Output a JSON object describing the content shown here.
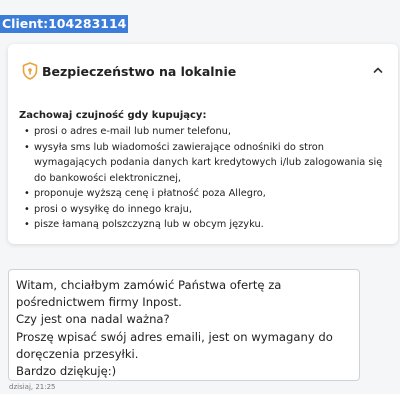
{
  "client_label": "Client:104283114",
  "security_panel": {
    "title": "Bezpieczeństwo na lokalnie",
    "heading": "Zachowaj czujność gdy kupujący:",
    "items": [
      "prosi o adres e-mail lub numer telefonu,",
      "wysyła sms lub wiadomości zawierające odnośniki do stron wymagających podania danych kart kredytowych i/lub zalogowania się do bankowości elektronicznej,",
      "proponuje wyższą cenę i płatność poza Allegro,",
      "prosi o wysyłkę do innego kraju,",
      "pisze łamaną polszczyzną lub w obcym języku."
    ],
    "accent_color": "#e8a33d"
  },
  "message": {
    "text": "Witam, chciałbym zamówić Państwa ofertę za pośrednictwem firmy Inpost.\nCzy jest ona nadal ważna?\nProszę wpisać swój adres emaili, jest on wymagany do doręczenia przesyłki.\nBardzo dziękuję:)",
    "timestamp": "dzisiaj, 21:25"
  },
  "icons": {
    "shield": "shield-icon",
    "collapse": "chevron-up-icon"
  },
  "colors": {
    "selection_highlight": "#3b7dd8",
    "background": "#f5f6f7"
  }
}
